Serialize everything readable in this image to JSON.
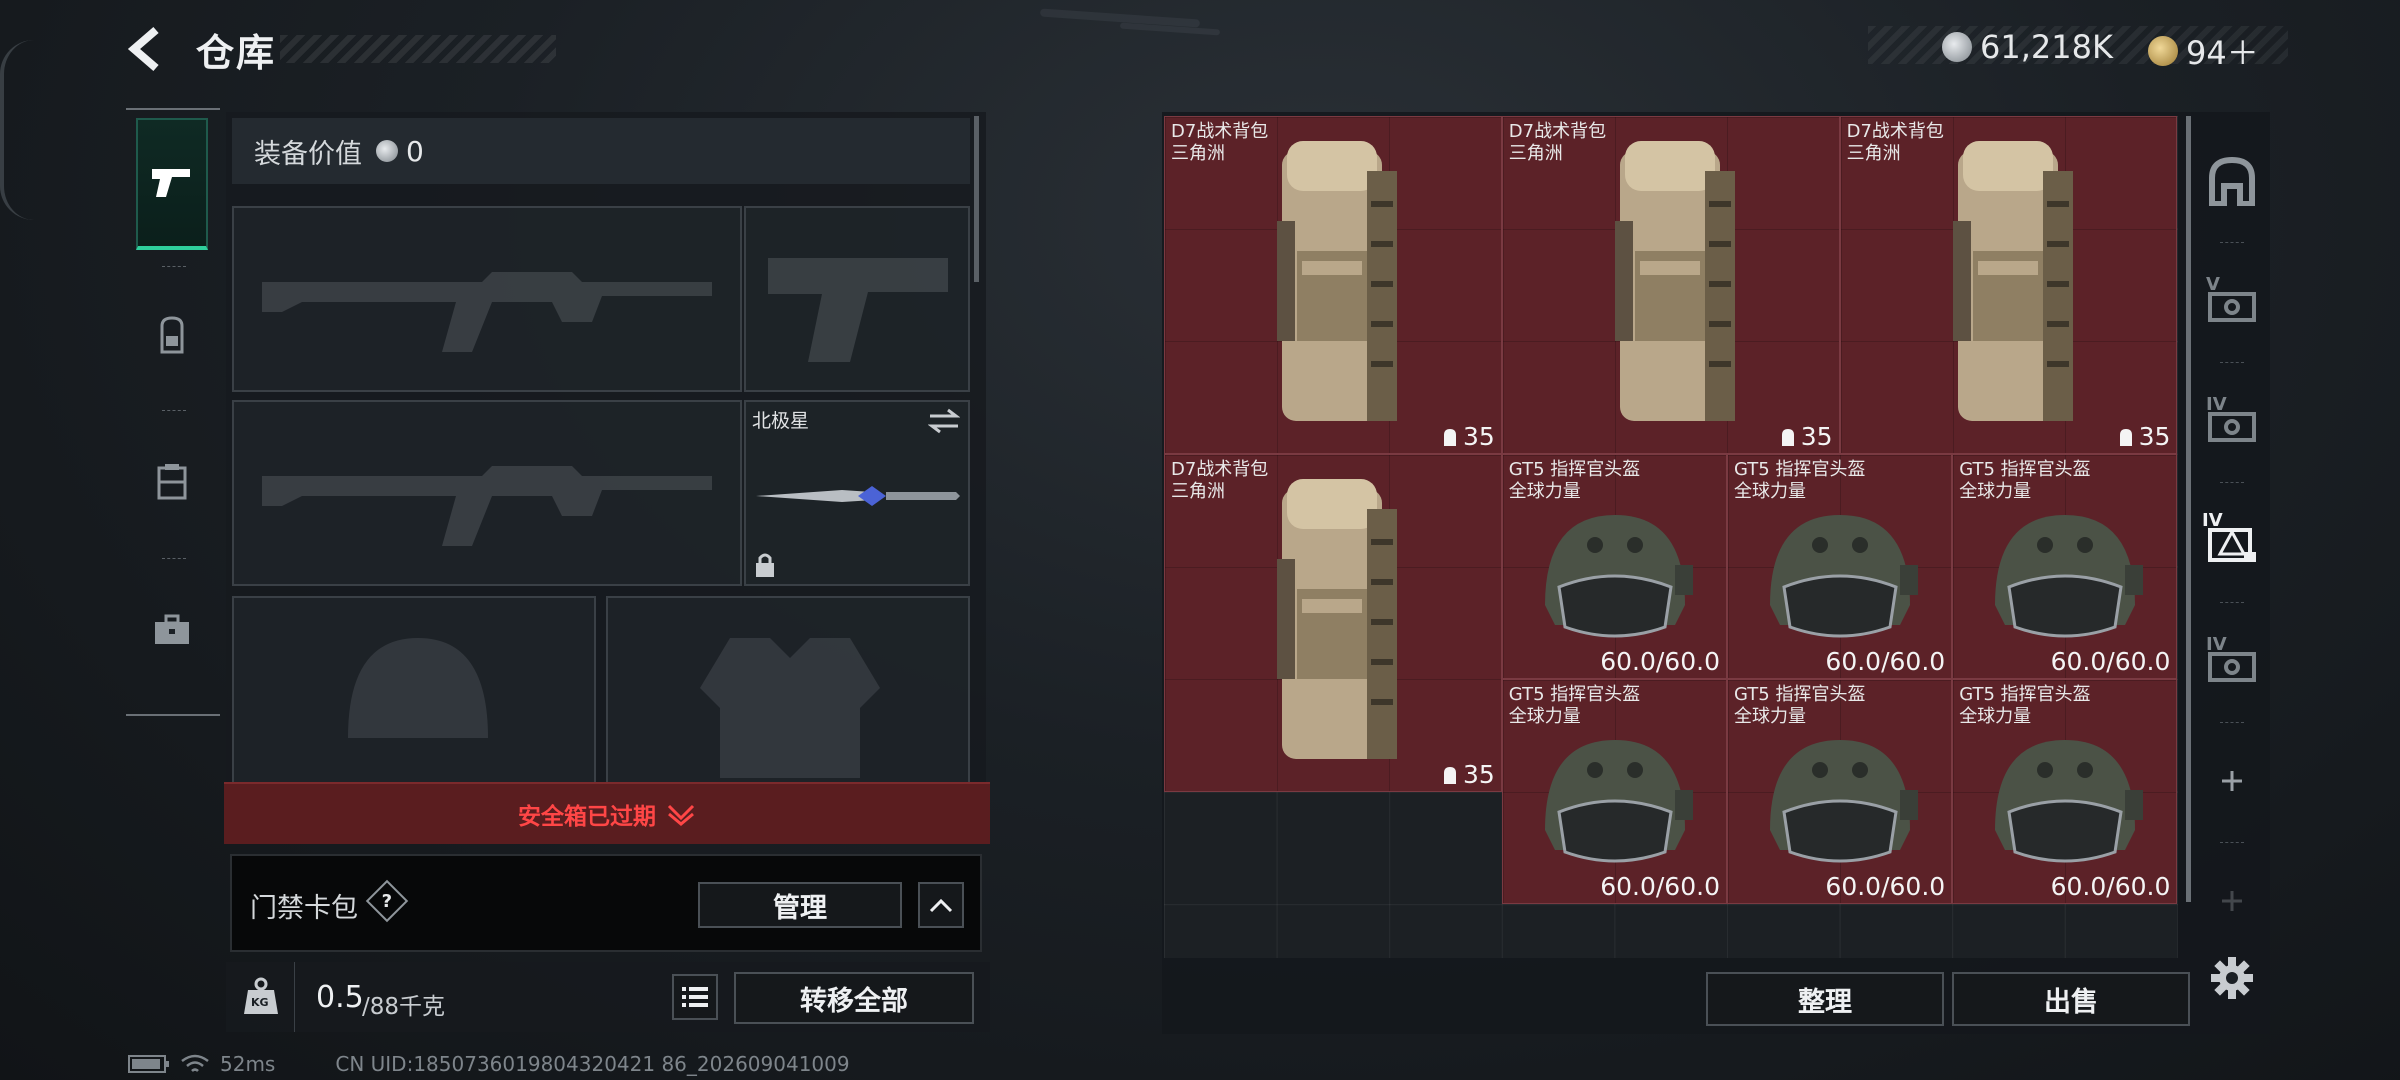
{
  "header": {
    "title": "仓库",
    "currency_silver": "61,218K",
    "currency_gold": "94＋",
    "silver_color": "#b9bec3",
    "gold_color": "#c9a65a"
  },
  "equip": {
    "value_label": "装备价值",
    "value": "0",
    "melee_name": "北极星",
    "safebox": "安全箱已过期"
  },
  "keycard": {
    "label": "门禁卡包",
    "help": "?",
    "manage": "管理"
  },
  "bottom": {
    "weight_current": "0.5",
    "weight_max": "/88千克",
    "transfer_all": "转移全部",
    "weight_icon": "KG"
  },
  "storage": {
    "items": [
      {
        "name1": "D7战术背包",
        "name2": "三角洲",
        "value": "35",
        "type": "backpack"
      },
      {
        "name1": "D7战术背包",
        "name2": "三角洲",
        "value": "35",
        "type": "backpack"
      },
      {
        "name1": "D7战术背包",
        "name2": "三角洲",
        "value": "35",
        "type": "backpack"
      },
      {
        "name1": "D7战术背包",
        "name2": "三角洲",
        "value": "35",
        "type": "backpack"
      },
      {
        "name1": "GT5 指挥官头盔",
        "name2": "全球力量",
        "value": "60.0/60.0",
        "type": "helmet"
      },
      {
        "name1": "GT5 指挥官头盔",
        "name2": "全球力量",
        "value": "60.0/60.0",
        "type": "helmet"
      },
      {
        "name1": "GT5 指挥官头盔",
        "name2": "全球力量",
        "value": "60.0/60.0",
        "type": "helmet"
      },
      {
        "name1": "GT5 指挥官头盔",
        "name2": "全球力量",
        "value": "60.0/60.0",
        "type": "helmet"
      },
      {
        "name1": "GT5 指挥官头盔",
        "name2": "全球力量",
        "value": "60.0/60.0",
        "type": "helmet"
      },
      {
        "name1": "GT5 指挥官头盔",
        "name2": "全球力量",
        "value": "60.0/60.0",
        "type": "helmet"
      }
    ],
    "sort": "整理",
    "sell": "出售",
    "tab_labels": [
      "V",
      "IV",
      "IV",
      "IV"
    ]
  },
  "status": {
    "ping": "52ms",
    "uid": "CN UID:1850736019804320421 86_202609041009"
  },
  "icons": [
    "back-arrow-icon",
    "pistol-icon",
    "backpack-icon",
    "chest-rig-icon",
    "briefcase-icon",
    "lock-icon",
    "swap-icon",
    "list-icon",
    "weight-icon",
    "home-icon",
    "plus-icon",
    "gear-icon",
    "chevron-up-icon",
    "chevron-down-icon",
    "battery-icon",
    "wifi-icon"
  ]
}
